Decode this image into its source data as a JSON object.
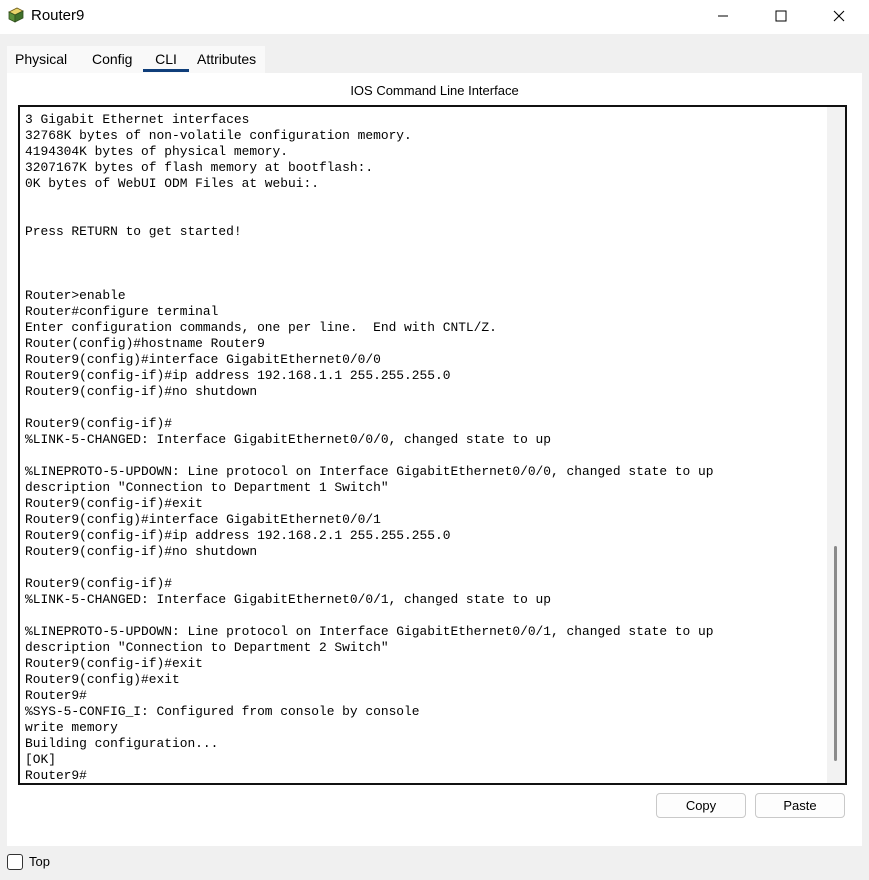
{
  "window": {
    "title": "Router9",
    "icon": "router-app-icon",
    "controls": [
      "minimize-icon",
      "maximize-icon",
      "close-icon"
    ]
  },
  "tabs": [
    {
      "label": "Physical",
      "active": false
    },
    {
      "label": "Config",
      "active": false
    },
    {
      "label": "CLI",
      "active": true
    },
    {
      "label": "Attributes",
      "active": false
    }
  ],
  "panel": {
    "heading": "IOS Command Line Interface"
  },
  "terminal": {
    "lines": [
      "3 Gigabit Ethernet interfaces",
      "32768K bytes of non-volatile configuration memory.",
      "4194304K bytes of physical memory.",
      "3207167K bytes of flash memory at bootflash:.",
      "0K bytes of WebUI ODM Files at webui:.",
      "",
      "",
      "Press RETURN to get started!",
      "",
      "",
      "",
      "Router>enable",
      "Router#configure terminal",
      "Enter configuration commands, one per line.  End with CNTL/Z.",
      "Router(config)#hostname Router9",
      "Router9(config)#interface GigabitEthernet0/0/0",
      "Router9(config-if)#ip address 192.168.1.1 255.255.255.0",
      "Router9(config-if)#no shutdown",
      "",
      "Router9(config-if)#",
      "%LINK-5-CHANGED: Interface GigabitEthernet0/0/0, changed state to up",
      "",
      "%LINEPROTO-5-UPDOWN: Line protocol on Interface GigabitEthernet0/0/0, changed state to up",
      "description \"Connection to Department 1 Switch\"",
      "Router9(config-if)#exit",
      "Router9(config)#interface GigabitEthernet0/0/1",
      "Router9(config-if)#ip address 192.168.2.1 255.255.255.0",
      "Router9(config-if)#no shutdown",
      "",
      "Router9(config-if)#",
      "%LINK-5-CHANGED: Interface GigabitEthernet0/0/1, changed state to up",
      "",
      "%LINEPROTO-5-UPDOWN: Line protocol on Interface GigabitEthernet0/0/1, changed state to up",
      "description \"Connection to Department 2 Switch\"",
      "Router9(config-if)#exit",
      "Router9(config)#exit",
      "Router9#",
      "%SYS-5-CONFIG_I: Configured from console by console",
      "write memory",
      "Building configuration...",
      "[OK]",
      "Router9#"
    ]
  },
  "buttons": {
    "copy": "Copy",
    "paste": "Paste"
  },
  "footer": {
    "top_label": "Top",
    "top_checked": false
  },
  "colors": {
    "active_tab_underline": "#0f3e7a",
    "window_background": "#f0f0f0"
  }
}
